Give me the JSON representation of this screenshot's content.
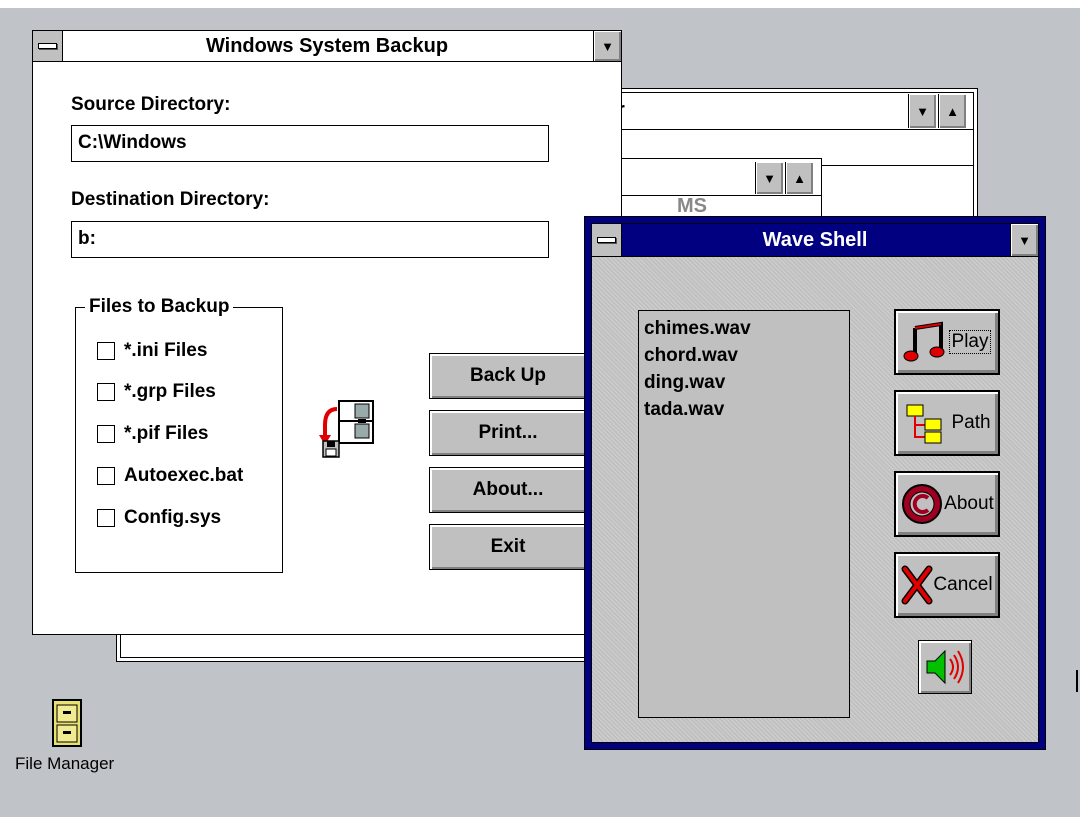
{
  "desktop_icon": {
    "label": "File Manager"
  },
  "bg_window_1": {
    "title_fragment": "r"
  },
  "bg_window_2": {
    "text_fragment": "MS"
  },
  "backup": {
    "title": "Windows System Backup",
    "source_label": "Source Directory:",
    "source_value": "C:\\Windows",
    "dest_label": "Destination Directory:",
    "dest_value": "b:",
    "group_label": "Files to Backup",
    "checkboxes": [
      "*.ini Files",
      "*.grp Files",
      "*.pif Files",
      "Autoexec.bat",
      "Config.sys"
    ],
    "buttons": {
      "backup": "Back Up",
      "print": "Print...",
      "about": "About...",
      "exit": "Exit"
    }
  },
  "wave": {
    "title": "Wave Shell",
    "files": [
      "chimes.wav",
      "chord.wav",
      "ding.wav",
      "tada.wav"
    ],
    "buttons": {
      "play": "Play",
      "path": "Path",
      "about": "About",
      "cancel": "Cancel"
    }
  },
  "colors": {
    "desktop": "#c0c4c8",
    "active_title": "#000080",
    "button_face": "#c0c0c0"
  }
}
